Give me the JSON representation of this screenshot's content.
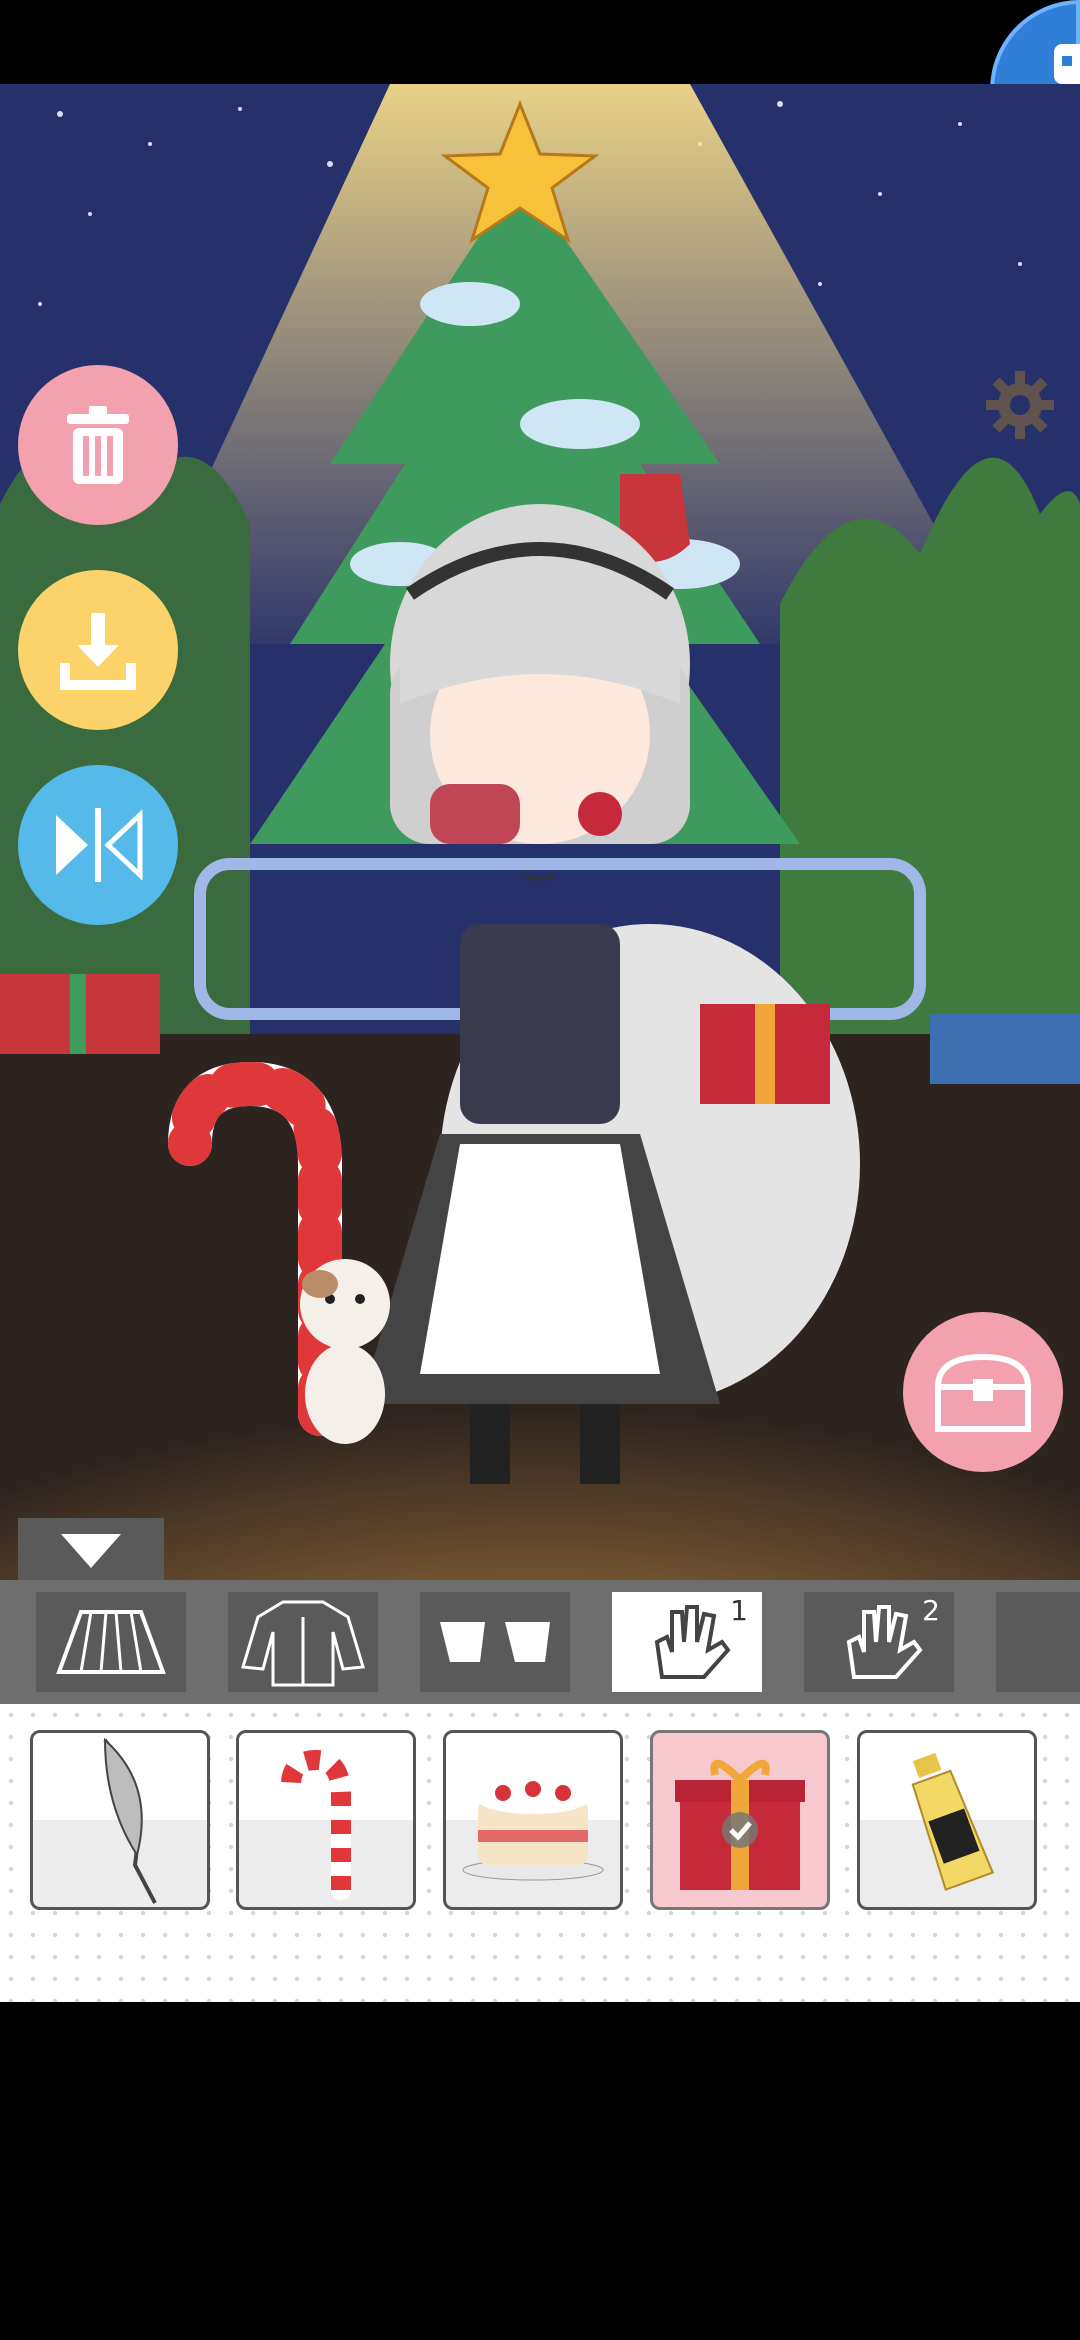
{
  "actions": {
    "delete": "trash-icon",
    "download": "download-icon",
    "flip": "flip-icon",
    "settings": "gear-icon",
    "chest": "chest-icon",
    "collapse": "triangle-down-icon"
  },
  "tabs": [
    {
      "name": "skirt",
      "icon": "skirt-icon",
      "label": ""
    },
    {
      "name": "coat",
      "icon": "coat-icon",
      "label": ""
    },
    {
      "name": "socks",
      "icon": "socks-icon",
      "label": ""
    },
    {
      "name": "hand-1",
      "icon": "hand-icon",
      "label": "1",
      "selected": true
    },
    {
      "name": "hand-2",
      "icon": "hand-icon",
      "label": "2"
    }
  ],
  "items": [
    {
      "name": "feather-sword",
      "icon": "feather-icon"
    },
    {
      "name": "candy-cane",
      "icon": "candy-cane-icon"
    },
    {
      "name": "cake",
      "icon": "cake-icon"
    },
    {
      "name": "gift-box",
      "icon": "gift-icon",
      "selected": true
    },
    {
      "name": "bottle",
      "icon": "bottle-icon"
    }
  ],
  "colors": {
    "delete_btn": "#f3a1ae",
    "download_btn": "#fbd36a",
    "flip_btn": "#55b9e9",
    "chest_btn": "#f3a1ae",
    "selected_tab": "#ffffff",
    "selected_item": "#f7c9cf",
    "sky": "#26306a",
    "ground": "#2e241f"
  }
}
